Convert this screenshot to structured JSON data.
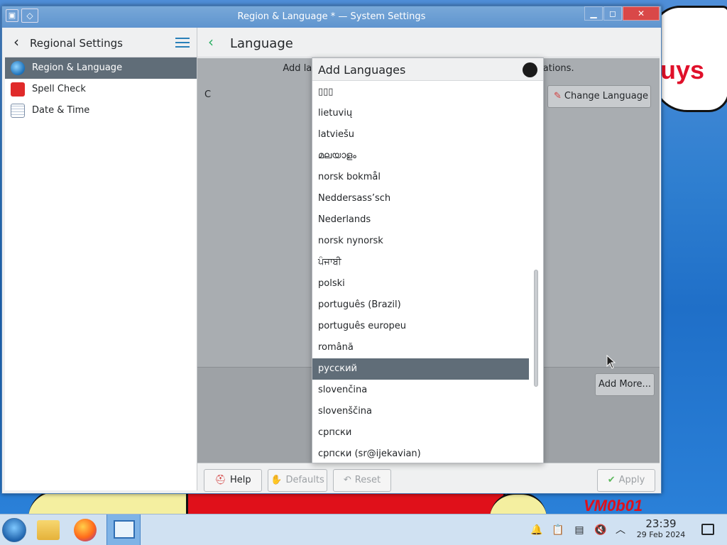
{
  "window": {
    "title": "Region & Language * — System Settings"
  },
  "sidebar": {
    "header": "Regional Settings",
    "items": [
      {
        "label": "Region & Language",
        "icon": "globe-icon",
        "active": true
      },
      {
        "label": "Spell Check",
        "icon": "spell-check-icon",
        "active": false
      },
      {
        "label": "Date & Time",
        "icon": "calendar-icon",
        "active": false
      }
    ]
  },
  "main": {
    "title": "Language",
    "info_text_left": "Add lang",
    "info_text_right": "ications.",
    "current_language": "C",
    "change_language_label": "Change Language",
    "add_more_label": "Add More...",
    "buttons": {
      "help": "Help",
      "defaults": "Defaults",
      "reset": "Reset",
      "apply": "Apply"
    }
  },
  "dialog": {
    "title": "Add Languages",
    "languages": [
      "▯▯▯",
      "lietuvių",
      "latviešu",
      "മലയാളം",
      "norsk bokmål",
      "Neddersass’sch",
      "Nederlands",
      "norsk nynorsk",
      "ਪੰਜਾਬੀ",
      "polski",
      "português (Brazil)",
      "português europeu",
      "română",
      "русский",
      "slovenčina",
      "slovenščina",
      "српски",
      "српски (sr@ijekavian)"
    ],
    "selected_index": 13
  },
  "wallpaper": {
    "text_top": "uys",
    "text_bottom": "VM0b01"
  },
  "taskbar": {
    "time": "23:39",
    "date": "29 Feb 2024"
  },
  "colors": {
    "selection": "#606d78",
    "accent": "#2980b9",
    "titlebar": "#5f94cf"
  }
}
